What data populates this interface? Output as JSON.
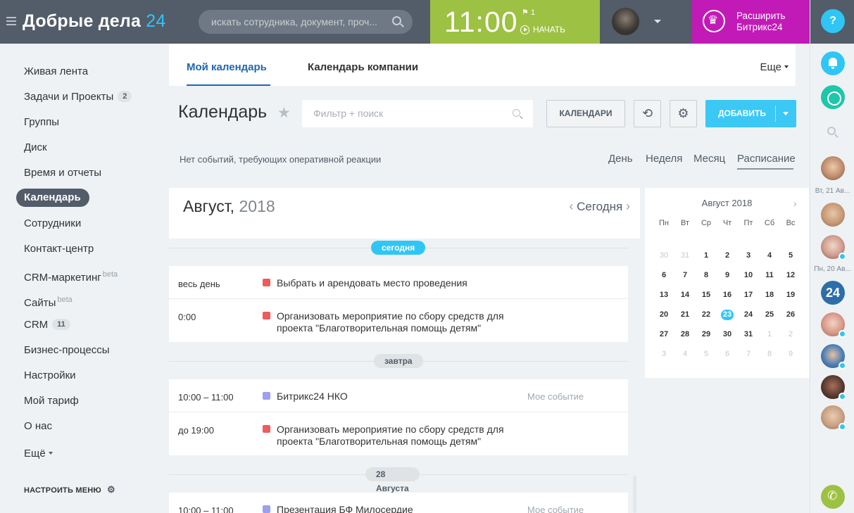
{
  "header": {
    "logo_text": "Добрые дела",
    "logo_num": "24",
    "search_placeholder": "искать сотрудника, документ, проч...",
    "clock": "11:00",
    "flag_count": "1",
    "start_label": "НАЧАТЬ",
    "upgrade_label": "Расширить Битрикс24"
  },
  "right_rail": {
    "help_label": "?",
    "date_1": "Вт, 21 Ав...",
    "date_2": "Пн, 20 Ав...",
    "b24_label": "24"
  },
  "sidebar": {
    "items": [
      {
        "label": "Живая лента"
      },
      {
        "label": "Задачи и Проекты",
        "count": "2"
      },
      {
        "label": "Группы"
      },
      {
        "label": "Диск"
      },
      {
        "label": "Время и отчеты"
      },
      {
        "label": "Календарь"
      },
      {
        "label": "Сотрудники"
      },
      {
        "label": "Контакт-центр"
      },
      {
        "label": "CRM-маркетинг",
        "sup": "beta"
      },
      {
        "label": "Сайты",
        "sup": "beta"
      },
      {
        "label": "CRM",
        "count": "11"
      },
      {
        "label": "Бизнес-процессы"
      },
      {
        "label": "Настройки"
      },
      {
        "label": "Мой тариф"
      },
      {
        "label": "О нас"
      },
      {
        "label": "Ещё"
      }
    ],
    "config_label": "НАСТРОИТЬ МЕНЮ"
  },
  "tabs": {
    "my_calendar": "Мой календарь",
    "company_calendar": "Календарь компании",
    "more": "Еще"
  },
  "toolbar": {
    "title": "Календарь",
    "filter_placeholder": "Фильтр + поиск",
    "calendars_button": "КАЛЕНДАРИ",
    "add_button": "ДОБАВИТЬ"
  },
  "infobar": {
    "text": "Нет событий, требующих оперативной реакции",
    "views": [
      "День",
      "Неделя",
      "Месяц",
      "Расписание"
    ]
  },
  "schedule": {
    "month": "Август,",
    "year": "2018",
    "today_label": "Сегодня",
    "days": [
      {
        "label": "сегодня",
        "events": [
          {
            "time": "весь день",
            "title": "Выбрать и арендовать место проведения",
            "title2": "",
            "tag": "",
            "color": "#f05b5b"
          },
          {
            "time": "0:00",
            "title": "Организовать мероприятие по сбору средств для",
            "title2": "проекта \"Благотворительная помощь детям\"",
            "tag": "",
            "color": "#f05b5b"
          }
        ]
      },
      {
        "label": "завтра",
        "events": [
          {
            "time": "10:00 – 11:00",
            "title": "Битрикс24 НКО",
            "title2": "",
            "tag": "Мое событие",
            "color": "#9d9ff0"
          },
          {
            "time": "до 19:00",
            "title": "Организовать мероприятие по сбору средств для",
            "title2": "проекта \"Благотворительная помощь детям\"",
            "tag": "",
            "color": "#f05b5b"
          }
        ]
      },
      {
        "label": "28 Августа",
        "events": [
          {
            "time": "10:00 – 11:00",
            "title": "Презентация БФ Милосердие",
            "title2": "",
            "tag": "Мое событие",
            "color": "#9d9ff0"
          }
        ]
      }
    ]
  },
  "mini_calendar": {
    "title": "Август 2018",
    "weekdays": [
      "Пн",
      "Вт",
      "Ср",
      "Чт",
      "Пт",
      "Сб",
      "Вс"
    ],
    "weeks": [
      [
        "30",
        "31",
        "1",
        "2",
        "3",
        "4",
        "5"
      ],
      [
        "6",
        "7",
        "8",
        "9",
        "10",
        "11",
        "12"
      ],
      [
        "13",
        "14",
        "15",
        "16",
        "17",
        "18",
        "19"
      ],
      [
        "20",
        "21",
        "22",
        "23",
        "24",
        "25",
        "26"
      ],
      [
        "27",
        "28",
        "29",
        "30",
        "31",
        "1",
        "2"
      ],
      [
        "3",
        "4",
        "5",
        "6",
        "7",
        "8",
        "9"
      ]
    ],
    "today": "23"
  }
}
